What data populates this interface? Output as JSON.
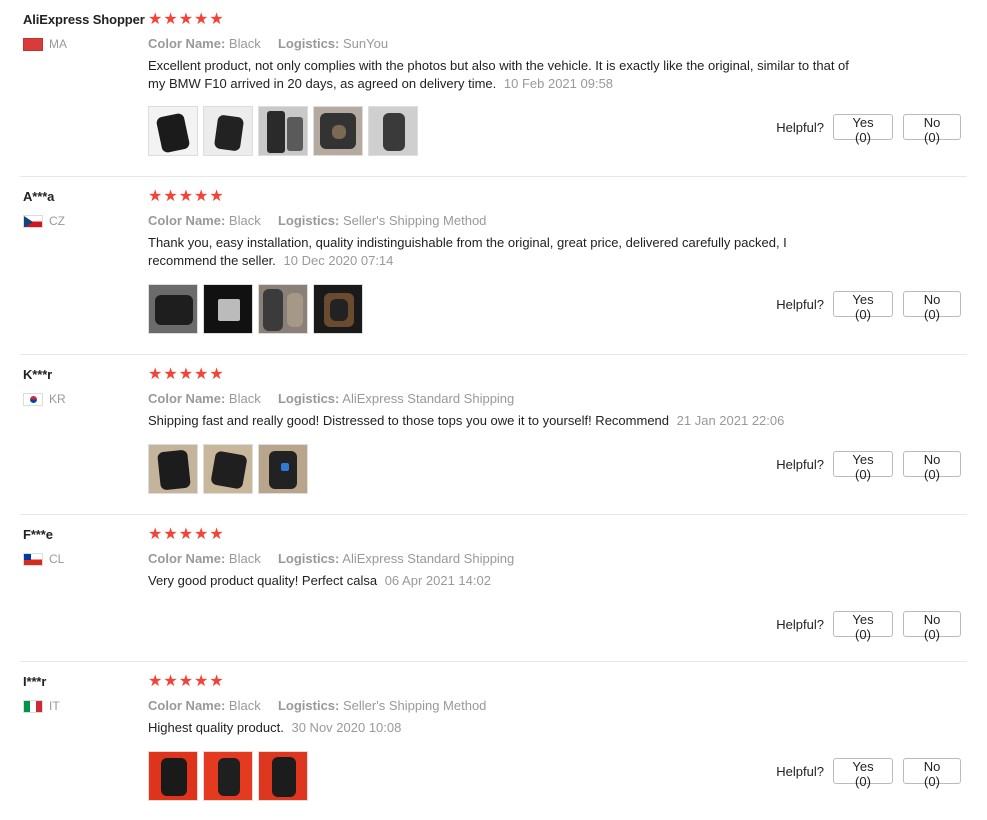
{
  "labels": {
    "color_name": "Color Name:",
    "logistics": "Logistics:",
    "helpful": "Helpful?"
  },
  "reviews": [
    {
      "user": "AliExpress Shopper",
      "country": "MA",
      "rating": 5,
      "color": "Black",
      "logistics": "SunYou",
      "text": "Excellent product, not only complies with the photos but also with the vehicle. It is exactly like the original, similar to that of my BMW F10 arrived in 20 days, as agreed on delivery time.",
      "date": "10 Feb 2021 09:58",
      "yes": "Yes (0)",
      "no": "No (0)",
      "photo_count": 5
    },
    {
      "user": "A***a",
      "country": "CZ",
      "rating": 5,
      "color": "Black",
      "logistics": "Seller's Shipping Method",
      "text": "Thank you, easy installation, quality indistinguishable from the original, great price, delivered carefully packed, I recommend the seller.",
      "date": "10 Dec 2020 07:14",
      "yes": "Yes (0)",
      "no": "No (0)",
      "photo_count": 4
    },
    {
      "user": "K***r",
      "country": "KR",
      "rating": 5,
      "color": "Black",
      "logistics": "AliExpress Standard Shipping",
      "text": "Shipping fast and really good! Distressed to those tops you owe it to yourself! Recommend",
      "date": "21 Jan 2021 22:06",
      "yes": "Yes (0)",
      "no": "No (0)",
      "photo_count": 3
    },
    {
      "user": "F***e",
      "country": "CL",
      "rating": 5,
      "color": "Black",
      "logistics": "AliExpress Standard Shipping",
      "text": "Very good product quality! Perfect calsa",
      "date": "06 Apr 2021 14:02",
      "yes": "Yes (0)",
      "no": "No (0)",
      "photo_count": 0
    },
    {
      "user": "I***r",
      "country": "IT",
      "rating": 5,
      "color": "Black",
      "logistics": "Seller's Shipping Method",
      "text": "Highest quality product.",
      "date": "30 Nov 2020 10:08",
      "yes": "Yes (0)",
      "no": "No (0)",
      "photo_count": 3
    }
  ],
  "colors": {
    "star": "#f44336",
    "muted_text": "#999999",
    "divider": "#e8e8e8"
  }
}
